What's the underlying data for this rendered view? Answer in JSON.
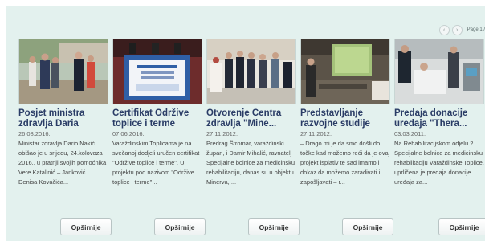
{
  "pager": {
    "prev_icon": "chevron-left-icon",
    "next_icon": "chevron-right-icon",
    "label": "Page 1 /"
  },
  "items": [
    {
      "title": "Posjet ministra zdravlja Daria Nakić...",
      "date": "26.08.2016.",
      "excerpt": "Ministar zdravlja Dario Nakić obišao je u srijedu, 24.kolovoza 2016., u pratnji svojih pomoćnika Vere Katalinić – Janković i Denisa Kovačića...",
      "button": "Opširnije"
    },
    {
      "title": "Certifikat Održive toplice i terme",
      "date": "07.06.2016.",
      "excerpt": "Varaždinskim Toplicama je na svečanoj dodjeli uručen certifikat \"Održive toplice i terme\". U projektu pod nazivom \"Održive toplice i terme\"...",
      "button": "Opširnije"
    },
    {
      "title": "Otvorenje Centra zdravlja \"Mine...",
      "date": "27.11.2012.",
      "excerpt": "Predrag Štromar, varaždinski župan, i Damir Mihalić, ravnatelj Specijalne bolnice za medicinsku rehabilitaciju, danas su u objektu Minerva, ...",
      "button": "Opširnije"
    },
    {
      "title": "Predstavljanje razvojne studije",
      "date": "27.11.2012.",
      "excerpt": "– Drago mi je da smo došli do točke kad možemo reći da je ovaj projekt isplativ te sad imamo i dokaz da možemo zaradivati i zapošljavati – r...",
      "button": "Opširnije"
    },
    {
      "title": "Predaja donacije uređaja \"Thera...",
      "date": "03.03.2011.",
      "excerpt": "Na Rehabilitacijskom odjelu 2 Specijalne bolnice za medicinsku rehabilitaciju Varaždinske Toplice, uprličena je predaja donacije uređaja za...",
      "button": "Opširnije"
    }
  ]
}
